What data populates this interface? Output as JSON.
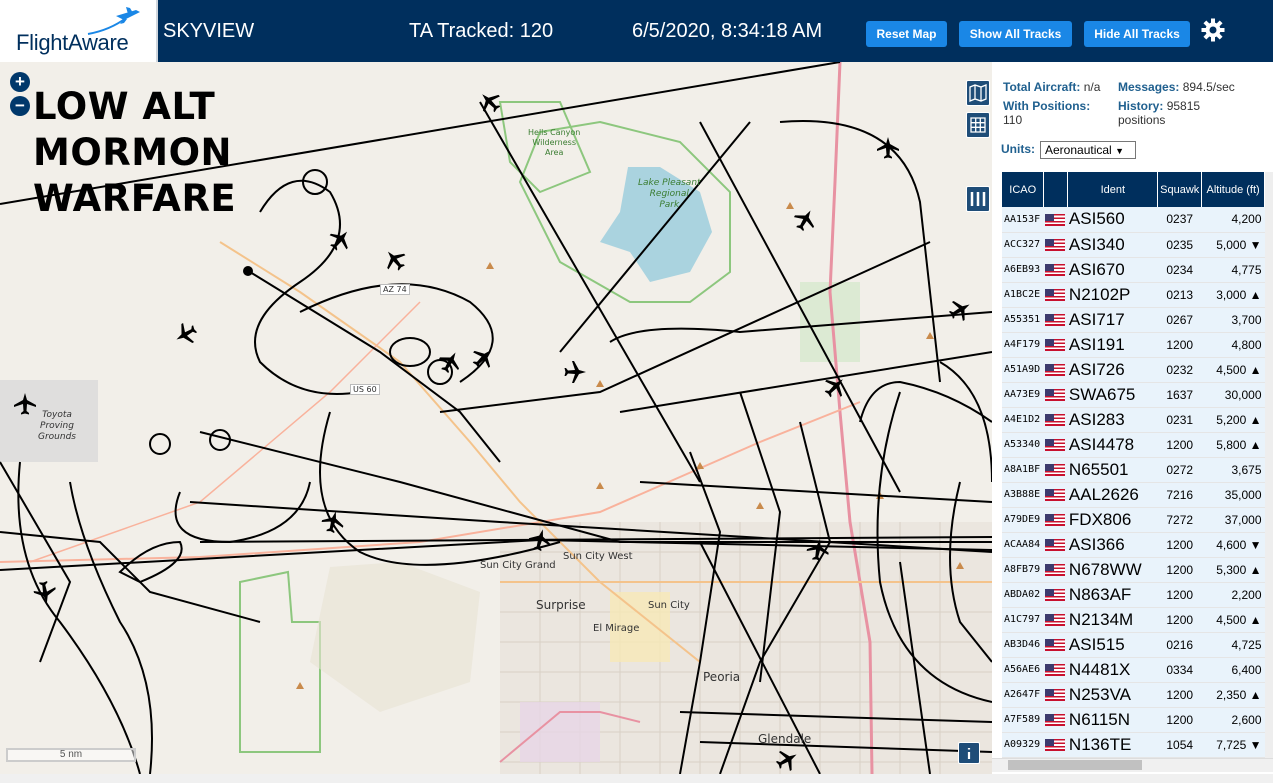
{
  "header": {
    "logo": "FlightAware",
    "brand": "SKYVIEW",
    "tracked": "TA Tracked: 120",
    "datetime": "6/5/2020, 8:34:18 AM",
    "reset_label": "Reset Map",
    "show_label": "Show All Tracks",
    "hide_label": "Hide All Tracks",
    "settings_icon": "gear-icon",
    "accent": "#002f5d",
    "button_color": "#1a87e6"
  },
  "map": {
    "zoom_in": "+",
    "zoom_out": "−",
    "overlay": [
      "LOW ALT",
      "MORMON",
      "WARFARE"
    ],
    "scale": "5 nm",
    "labels": {
      "hells_canyon": [
        "Hells Canyon",
        "Wilderness",
        "Area"
      ],
      "lake": [
        "Lake Pleasant",
        "Regional",
        "Park"
      ],
      "toyota": [
        "Toyota",
        "Proving",
        "Grounds"
      ],
      "a74": "AZ 74",
      "us60": "US 60",
      "sun_city_grand": "Sun City Grand",
      "sun_city_west": "Sun City West",
      "surprise": "Surprise",
      "sun_city": "Sun City",
      "el_mirage": "El Mirage",
      "peoria": "Peoria",
      "glendale": "Glendale"
    }
  },
  "stats": {
    "total_label": "Total Aircraft:",
    "total_value": "n/a",
    "messages_label": "Messages:",
    "messages_value": "894.5/sec",
    "positions_label": "With Positions:",
    "positions_value": "110",
    "history_label": "History:",
    "history_value": "95815",
    "history_unit": "positions",
    "units_label": "Units:",
    "units_value": "Aeronautical"
  },
  "table": {
    "headers": [
      "ICAO",
      "",
      "Ident",
      "Squawk",
      "Altitude (ft)"
    ],
    "rows": [
      {
        "icao": "AA153F",
        "ident": "ASI560",
        "squawk": "0237",
        "alt": "4,200"
      },
      {
        "icao": "ACC327",
        "ident": "ASI340",
        "squawk": "0235",
        "alt": "5,000 ▼"
      },
      {
        "icao": "A6EB93",
        "ident": "ASI670",
        "squawk": "0234",
        "alt": "4,775"
      },
      {
        "icao": "A1BC2E",
        "ident": "N2102P",
        "squawk": "0213",
        "alt": "3,000 ▲"
      },
      {
        "icao": "A55351",
        "ident": "ASI717",
        "squawk": "0267",
        "alt": "3,700"
      },
      {
        "icao": "A4F179",
        "ident": "ASI191",
        "squawk": "1200",
        "alt": "4,800"
      },
      {
        "icao": "A51A9D",
        "ident": "ASI726",
        "squawk": "0232",
        "alt": "4,500 ▲"
      },
      {
        "icao": "AA73E9",
        "ident": "SWA675",
        "squawk": "1637",
        "alt": "30,000"
      },
      {
        "icao": "A4E1D2",
        "ident": "ASI283",
        "squawk": "0231",
        "alt": "5,200 ▲"
      },
      {
        "icao": "A53340",
        "ident": "ASI4478",
        "squawk": "1200",
        "alt": "5,800 ▲"
      },
      {
        "icao": "A8A1BF",
        "ident": "N65501",
        "squawk": "0272",
        "alt": "3,675"
      },
      {
        "icao": "A3B88E",
        "ident": "AAL2626",
        "squawk": "7216",
        "alt": "35,000"
      },
      {
        "icao": "A79DE9",
        "ident": "FDX806",
        "squawk": "7272",
        "alt": "37,000"
      },
      {
        "icao": "ACAA84",
        "ident": "ASI366",
        "squawk": "1200",
        "alt": "4,600 ▼"
      },
      {
        "icao": "A8FB79",
        "ident": "N678WW",
        "squawk": "1200",
        "alt": "5,300 ▲"
      },
      {
        "icao": "ABDA02",
        "ident": "N863AF",
        "squawk": "1200",
        "alt": "2,200"
      },
      {
        "icao": "A1C797",
        "ident": "N2134M",
        "squawk": "1200",
        "alt": "4,500 ▲"
      },
      {
        "icao": "AB3D46",
        "ident": "ASI515",
        "squawk": "0216",
        "alt": "4,725"
      },
      {
        "icao": "A56AE6",
        "ident": "N4481X",
        "squawk": "0334",
        "alt": "6,400"
      },
      {
        "icao": "A2647F",
        "ident": "N253VA",
        "squawk": "1200",
        "alt": "2,350 ▲"
      },
      {
        "icao": "A7F589",
        "ident": "N6115N",
        "squawk": "1200",
        "alt": "2,600"
      },
      {
        "icao": "A09329",
        "ident": "N136TE",
        "squawk": "1054",
        "alt": "7,725 ▼"
      }
    ]
  }
}
